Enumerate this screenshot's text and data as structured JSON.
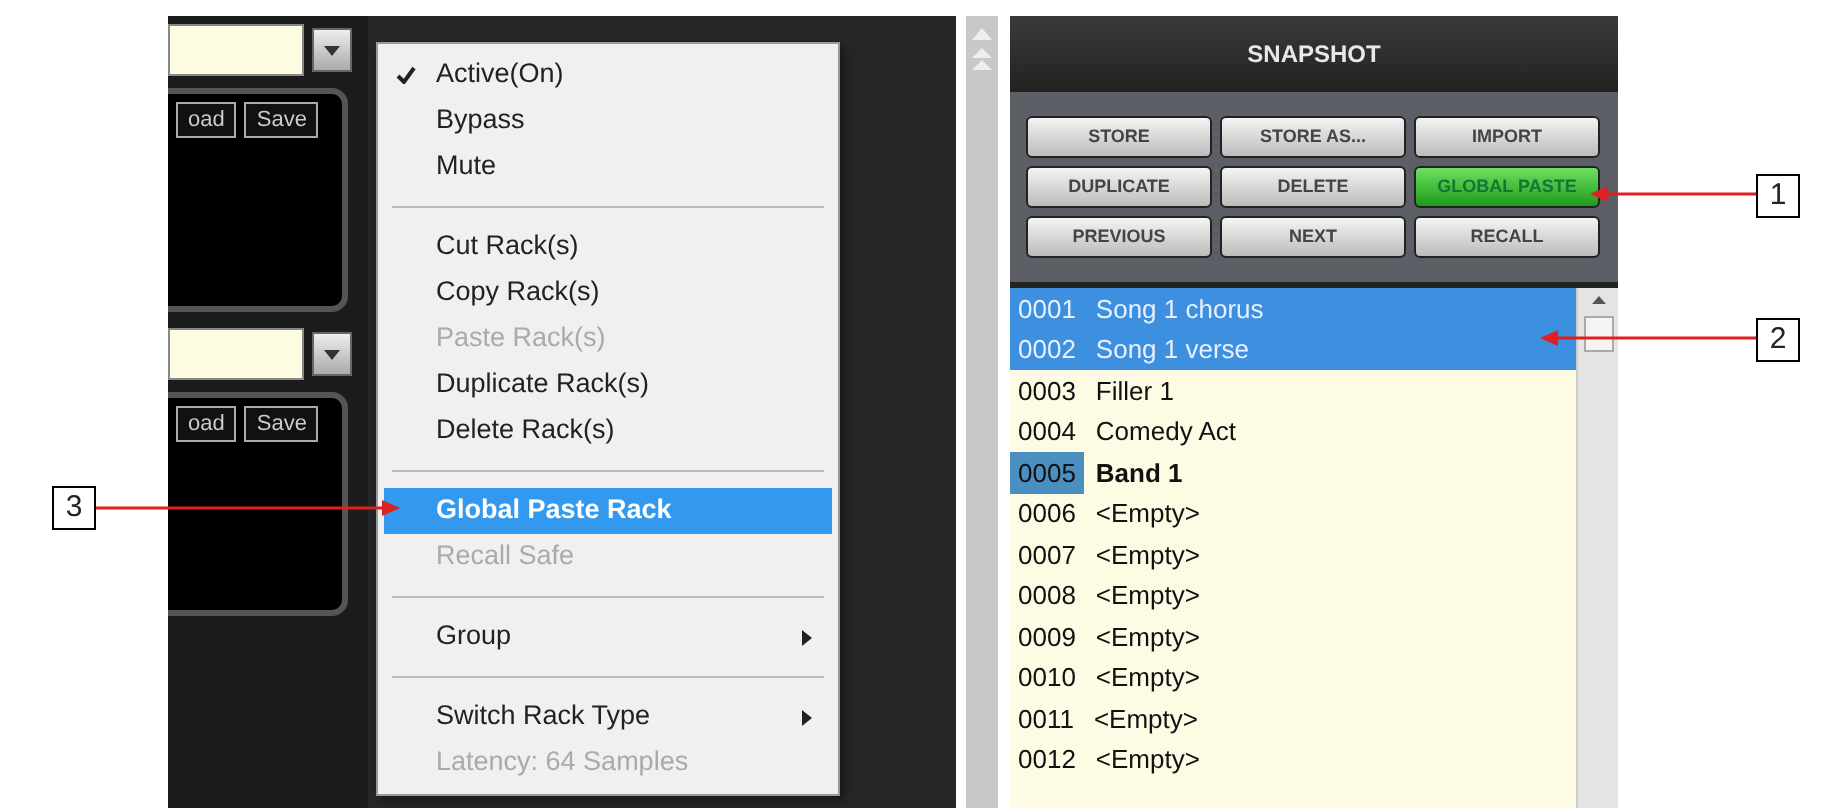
{
  "racks": [
    {
      "buttons": [
        "oad",
        "Save"
      ]
    },
    {
      "buttons": [
        "oad",
        "Save"
      ]
    }
  ],
  "context_menu": {
    "items": [
      {
        "kind": "item",
        "label": "Active(On)",
        "checked": true,
        "disabled": false,
        "selected": false,
        "submenu": false
      },
      {
        "kind": "item",
        "label": "Bypass",
        "checked": false,
        "disabled": false,
        "selected": false,
        "submenu": false
      },
      {
        "kind": "item",
        "label": "Mute",
        "checked": false,
        "disabled": false,
        "selected": false,
        "submenu": false
      },
      {
        "kind": "separator"
      },
      {
        "kind": "item",
        "label": "Cut Rack(s)",
        "checked": false,
        "disabled": false,
        "selected": false,
        "submenu": false
      },
      {
        "kind": "item",
        "label": "Copy Rack(s)",
        "checked": false,
        "disabled": false,
        "selected": false,
        "submenu": false
      },
      {
        "kind": "item",
        "label": "Paste Rack(s)",
        "checked": false,
        "disabled": true,
        "selected": false,
        "submenu": false
      },
      {
        "kind": "item",
        "label": "Duplicate Rack(s)",
        "checked": false,
        "disabled": false,
        "selected": false,
        "submenu": false
      },
      {
        "kind": "item",
        "label": "Delete Rack(s)",
        "checked": false,
        "disabled": false,
        "selected": false,
        "submenu": false
      },
      {
        "kind": "separator"
      },
      {
        "kind": "item",
        "label": "Global Paste Rack",
        "checked": false,
        "disabled": false,
        "selected": true,
        "submenu": false
      },
      {
        "kind": "item",
        "label": "Recall Safe",
        "checked": false,
        "disabled": true,
        "selected": false,
        "submenu": false
      },
      {
        "kind": "separator"
      },
      {
        "kind": "item",
        "label": "Group",
        "checked": false,
        "disabled": false,
        "selected": false,
        "submenu": true
      },
      {
        "kind": "separator"
      },
      {
        "kind": "item",
        "label": "Switch Rack Type",
        "checked": false,
        "disabled": false,
        "selected": false,
        "submenu": true
      },
      {
        "kind": "item",
        "label": "Latency: 64 Samples",
        "checked": false,
        "disabled": true,
        "selected": false,
        "submenu": false
      }
    ]
  },
  "snapshot": {
    "title": "SNAPSHOT",
    "buttons": [
      {
        "label": "STORE",
        "active": false
      },
      {
        "label": "STORE AS...",
        "active": false
      },
      {
        "label": "IMPORT",
        "active": false
      },
      {
        "label": "DUPLICATE",
        "active": false
      },
      {
        "label": "DELETE",
        "active": false
      },
      {
        "label": "GLOBAL PASTE",
        "active": true
      },
      {
        "label": "PREVIOUS",
        "active": false
      },
      {
        "label": "NEXT",
        "active": false
      },
      {
        "label": "RECALL",
        "active": false
      }
    ],
    "rows": [
      {
        "number": "0001",
        "name": "Song 1 chorus",
        "selected": true,
        "current": false
      },
      {
        "number": "0002",
        "name": "Song 1 verse",
        "selected": true,
        "current": false
      },
      {
        "number": "0003",
        "name": "Filler 1",
        "selected": false,
        "current": false
      },
      {
        "number": "0004",
        "name": "Comedy Act",
        "selected": false,
        "current": false
      },
      {
        "number": "0005",
        "name": "Band 1",
        "selected": false,
        "current": true
      },
      {
        "number": "0006",
        "name": "<Empty>",
        "selected": false,
        "current": false
      },
      {
        "number": "0007",
        "name": "<Empty>",
        "selected": false,
        "current": false
      },
      {
        "number": "0008",
        "name": "<Empty>",
        "selected": false,
        "current": false
      },
      {
        "number": "0009",
        "name": "<Empty>",
        "selected": false,
        "current": false
      },
      {
        "number": "0010",
        "name": "<Empty>",
        "selected": false,
        "current": false
      },
      {
        "number": "0011",
        "name": "<Empty>",
        "selected": false,
        "current": false
      },
      {
        "number": "0012",
        "name": "<Empty>",
        "selected": false,
        "current": false
      }
    ]
  },
  "callouts": [
    {
      "label": "1"
    },
    {
      "label": "2"
    },
    {
      "label": "3"
    }
  ]
}
